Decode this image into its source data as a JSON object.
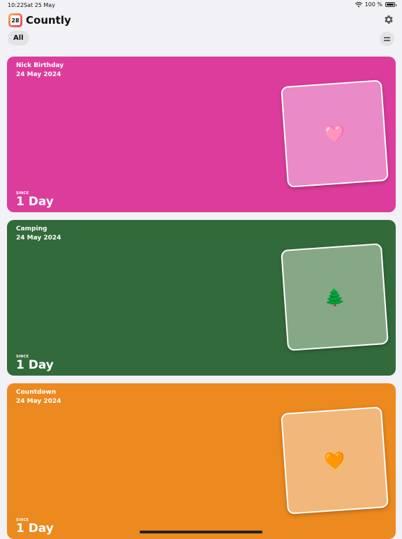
{
  "status_bar": {
    "time": "10:22",
    "date": "Sat 25 May",
    "battery_percent": "100 %"
  },
  "app": {
    "logo_text": "28",
    "title": "Countly"
  },
  "filters": {
    "all_label": "All"
  },
  "cards": [
    {
      "title": "Nick Birthday",
      "date": "24 May 2024",
      "since_label": "SINCE",
      "count": "1 Day",
      "emoji": "🩷",
      "emoji_name": "pink-heart-icon",
      "color": "#dc3d9c",
      "tile_color": "#ea8ac6"
    },
    {
      "title": "Camping",
      "date": "24 May 2024",
      "since_label": "SINCE",
      "count": "1 Day",
      "emoji": "🌲",
      "emoji_name": "evergreen-tree-icon",
      "color": "#336a3b",
      "tile_color": "#86a886"
    },
    {
      "title": "Countdown",
      "date": "24 May 2024",
      "since_label": "SINCE",
      "count": "1 Day",
      "emoji": "🧡",
      "emoji_name": "orange-heart-icon",
      "color": "#ec891f",
      "tile_color": "#f2b77a"
    }
  ]
}
